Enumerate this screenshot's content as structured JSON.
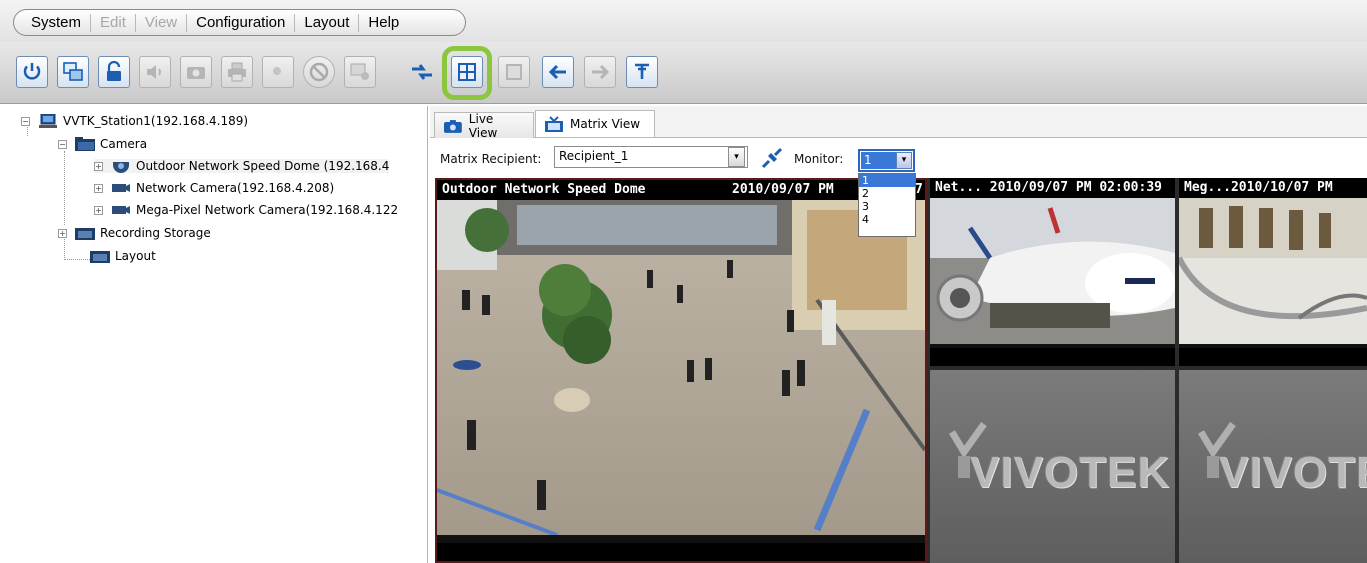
{
  "menubar": {
    "items": [
      {
        "label": "System",
        "enabled": true
      },
      {
        "label": "Edit",
        "enabled": false
      },
      {
        "label": "View",
        "enabled": false
      },
      {
        "label": "Configuration",
        "enabled": true
      },
      {
        "label": "Layout",
        "enabled": true
      },
      {
        "label": "Help",
        "enabled": true
      }
    ]
  },
  "toolbar": {
    "buttons": [
      {
        "name": "power-button",
        "icon": "power-icon",
        "enabled": true
      },
      {
        "name": "switch-view-button",
        "icon": "window-swap-icon",
        "enabled": true
      },
      {
        "name": "lock-button",
        "icon": "unlock-icon",
        "enabled": true
      },
      {
        "name": "audio-button",
        "icon": "speaker-icon",
        "enabled": false
      },
      {
        "name": "snapshot-button",
        "icon": "camera-icon",
        "enabled": false
      },
      {
        "name": "print-button",
        "icon": "printer-icon",
        "enabled": false
      },
      {
        "name": "zoom-button",
        "icon": "zoom-icon",
        "enabled": false
      },
      {
        "name": "stop-all-button",
        "icon": "prohibit-icon",
        "enabled": false
      },
      {
        "name": "display-settings-button",
        "icon": "monitor-settings-icon",
        "enabled": false
      },
      {
        "name": "matrix-sync-button",
        "icon": "arrows-exchange-icon",
        "enabled": true
      },
      {
        "name": "layout-grid-button",
        "icon": "grid-icon",
        "enabled": true,
        "highlighted": true
      },
      {
        "name": "fullscreen-button",
        "icon": "fullscreen-icon",
        "enabled": false
      },
      {
        "name": "back-button",
        "icon": "arrow-left-icon",
        "enabled": true
      },
      {
        "name": "forward-button",
        "icon": "arrow-right-icon",
        "enabled": false
      },
      {
        "name": "pin-button",
        "icon": "pin-icon",
        "enabled": true
      }
    ],
    "highlight_color": "#8cc63f"
  },
  "tree": {
    "root": "VVTK_Station1(192.168.4.189)",
    "camera_group": "Camera",
    "cameras": [
      "Outdoor Network Speed Dome (192.168.4",
      "Network Camera(192.168.4.208)",
      "Mega-Pixel Network Camera(192.168.4.122"
    ],
    "recording_storage": "Recording Storage",
    "layout": "Layout",
    "expander_plus": "+",
    "expander_minus": "−"
  },
  "tabs": {
    "live_view": "Live View",
    "matrix_view": "Matrix View",
    "active": "Matrix View"
  },
  "matrix": {
    "recipient_label": "Matrix Recipient:",
    "recipient_value": "Recipient_1",
    "monitor_label": "Monitor:",
    "monitor_value": "1",
    "monitor_options": [
      "1",
      "2",
      "3",
      "4"
    ],
    "dropdown_arrow": "▾"
  },
  "cells": {
    "main_title": "Outdoor Network Speed Dome",
    "main_time": "2010/09/07  PM",
    "main_time_suffix": "7",
    "cell2_title": "Net... 2010/09/07  PM 02:00:39",
    "cell3_title": "Meg...2010/10/07  PM",
    "watermark": "VIVOTEK"
  },
  "colors": {
    "accent": "#3a78d8",
    "highlight": "#8cc63f",
    "title_bg": "#000000",
    "placeholder_bg": "#6f6f6f"
  }
}
